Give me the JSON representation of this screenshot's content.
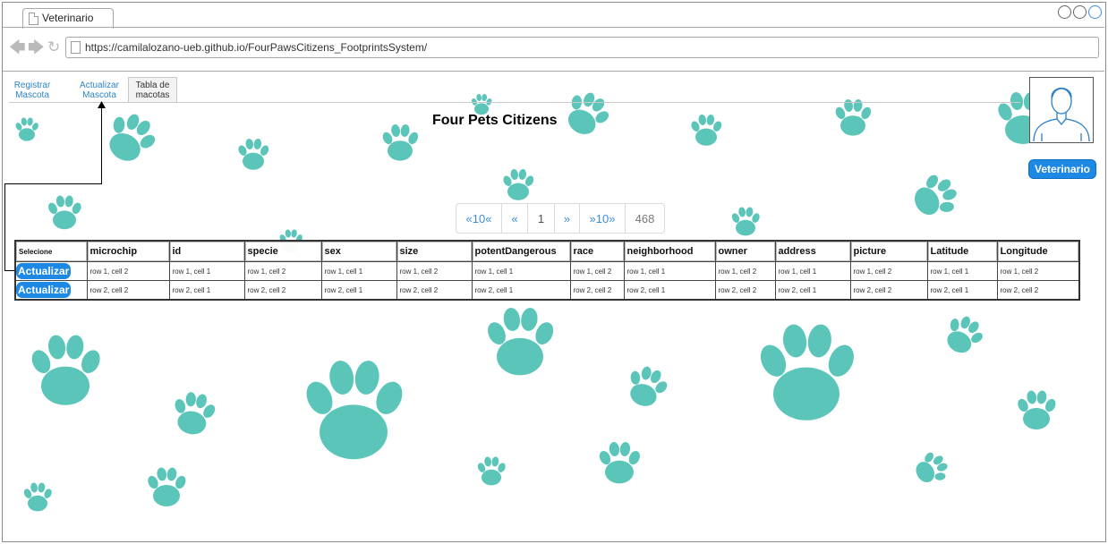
{
  "browser": {
    "tab_title": "Veterinario",
    "url": "https://camilalozano-ueb.github.io/FourPawsCitizens_FootprintsSystem/"
  },
  "nav_tabs": [
    {
      "line1": "Registrar",
      "line2": "Mascota"
    },
    {
      "line1": "Actualizar",
      "line2": "Mascota"
    },
    {
      "line1": "Tabla de",
      "line2": "macotas"
    }
  ],
  "page": {
    "title": "Four Pets Citizens",
    "user_button": "Veterinario"
  },
  "pagination": [
    "«10«",
    "«",
    "1",
    "»",
    "»10»",
    "468"
  ],
  "table": {
    "headers": [
      "Selecione",
      "microchip",
      "id",
      "specie",
      "sex",
      "size",
      "potentDangerous",
      "race",
      "neighborhood",
      "owner",
      "address",
      "picture",
      "Latitude",
      "Longitude"
    ],
    "action_label": "Actualizar",
    "rows": [
      [
        "row 1, cell 2",
        "row 1, cell 1",
        "row 1, cell 2",
        "row 1, cell 1",
        "row 1, cell 2",
        "row 1, cell 1",
        "row 1, cell 2",
        "row 1, cell 1",
        "row 1, cell 2",
        "row 1, cell 1",
        "row 1, cell 2",
        "row 1, cell 1",
        "row 1, cell 2"
      ],
      [
        "row 2, cell 2",
        "row 2, cell 1",
        "row 2, cell 2",
        "row 2, cell 1",
        "row 2, cell 2",
        "row 2, cell 1",
        "row 2, cell 2",
        "row 2, cell 1",
        "row 2, cell 2",
        "row 2, cell 1",
        "row 2, cell 2",
        "row 2, cell 1",
        "row 2, cell 2"
      ]
    ]
  },
  "colors": {
    "accent": "#1e88e5",
    "paw": "#5bc5b9"
  }
}
